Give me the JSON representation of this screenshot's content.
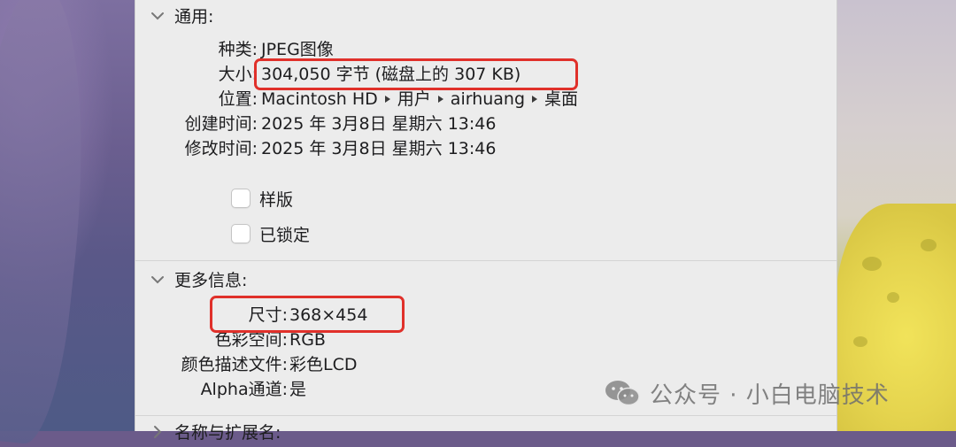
{
  "general": {
    "title": "通用:",
    "rows": [
      {
        "label": "种类:",
        "value": "JPEG图像"
      },
      {
        "label": "大小:",
        "value": "304,050 字节 (磁盘上的 307 KB)"
      },
      {
        "label": "位置:",
        "path": [
          "Macintosh HD",
          "用户",
          "airhuang",
          "桌面"
        ]
      },
      {
        "label": "创建时间:",
        "value": "2025 年 3月8日 星期六 13:46"
      },
      {
        "label": "修改时间:",
        "value": "2025 年 3月8日 星期六 13:46"
      }
    ],
    "checkboxes": [
      {
        "label": "样版",
        "checked": false
      },
      {
        "label": "已锁定",
        "checked": false
      }
    ]
  },
  "more_info": {
    "title": "更多信息:",
    "rows": [
      {
        "label": "尺寸:",
        "value": "368×454"
      },
      {
        "label": "色彩空间:",
        "value": "RGB"
      },
      {
        "label": "颜色描述文件:",
        "value": "彩色LCD"
      },
      {
        "label": "Alpha通道:",
        "value": "是"
      }
    ]
  },
  "next_section": {
    "title": "名称与扩展名:"
  },
  "watermark": {
    "text": "公众号 · 小白电脑技术",
    "icon": "wechat-icon"
  },
  "colors": {
    "highlight": "#e0302a",
    "panel_bg": "#ececec"
  }
}
